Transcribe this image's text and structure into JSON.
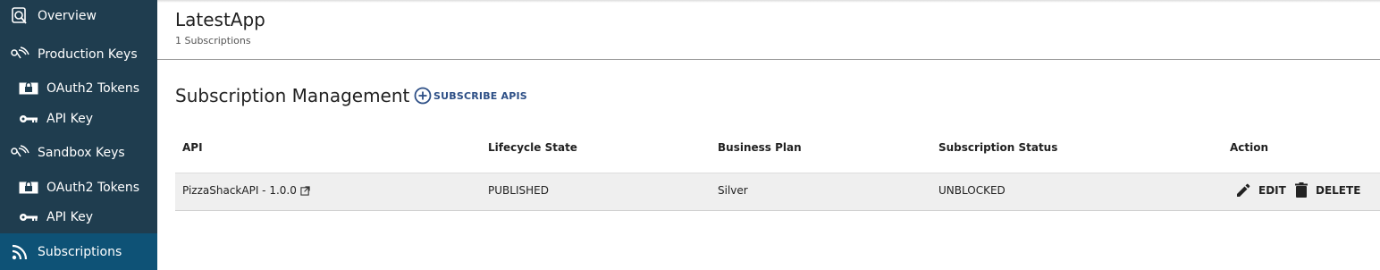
{
  "sidebar": {
    "items": [
      {
        "label": "Overview",
        "icon": "search-doc-icon"
      },
      {
        "label": "Production Keys",
        "icon": "keys-icon"
      },
      {
        "label": "OAuth2 Tokens",
        "icon": "lock-icon"
      },
      {
        "label": "API Key",
        "icon": "key-icon"
      },
      {
        "label": "Sandbox Keys",
        "icon": "keys-icon"
      },
      {
        "label": "OAuth2 Tokens",
        "icon": "lock-icon"
      },
      {
        "label": "API Key",
        "icon": "key-icon"
      },
      {
        "label": "Subscriptions",
        "icon": "rss-icon"
      }
    ],
    "active": "Subscriptions"
  },
  "header": {
    "title": "LatestApp",
    "subtitle": "1 Subscriptions"
  },
  "section": {
    "title": "Subscription Management",
    "subscribe_label": "SUBSCRIBE APIS"
  },
  "table": {
    "columns": [
      "API",
      "Lifecycle State",
      "Business Plan",
      "Subscription Status",
      "Action"
    ],
    "rows": [
      {
        "api": "PizzaShackAPI - 1.0.0",
        "lifecycle": "PUBLISHED",
        "plan": "Silver",
        "status": "UNBLOCKED"
      }
    ],
    "actions": {
      "edit": "EDIT",
      "delete": "DELETE"
    }
  },
  "colors": {
    "sidebar_bg": "#1f3d4f",
    "sidebar_active": "#0e5276",
    "accent": "#2d4f86",
    "row_bg": "#efefef"
  }
}
